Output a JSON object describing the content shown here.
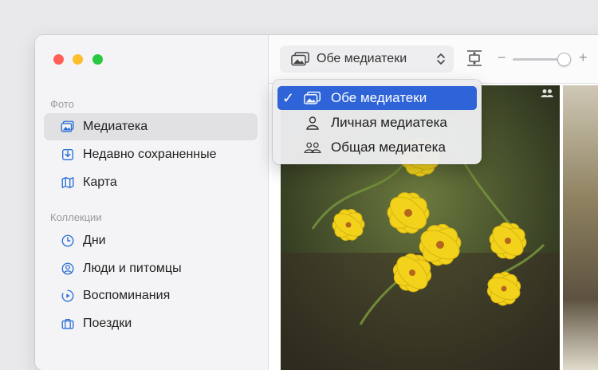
{
  "window": {
    "controls": [
      "close",
      "minimize",
      "zoom"
    ]
  },
  "sidebar": {
    "section_photos": "Фото",
    "photos_items": [
      {
        "label": "Медиатека",
        "icon": "photo-library-icon",
        "selected": true
      },
      {
        "label": "Недавно сохраненные",
        "icon": "download-tray-icon"
      },
      {
        "label": "Карта",
        "icon": "map-icon"
      }
    ],
    "section_collections": "Коллекции",
    "collection_items": [
      {
        "label": "Дни",
        "icon": "clock-icon"
      },
      {
        "label": "Люди и питомцы",
        "icon": "person-circle-icon"
      },
      {
        "label": "Воспоминания",
        "icon": "memories-play-icon"
      },
      {
        "label": "Поездки",
        "icon": "suitcase-icon"
      }
    ]
  },
  "toolbar": {
    "library_select_value": "Обе медиатеки",
    "zoom_level": 0.9
  },
  "dropdown": {
    "items": [
      {
        "label": "Обе медиатеки",
        "icon": "both-libraries-icon",
        "checked": true
      },
      {
        "label": "Личная медиатека",
        "icon": "person-icon",
        "checked": false
      },
      {
        "label": "Общая медиатека",
        "icon": "people-icon",
        "checked": false
      }
    ]
  },
  "colors": {
    "accent": "#2f64d8",
    "sidebar_icon": "#2b6fd6",
    "flower_yellow": "#f2d21b"
  }
}
